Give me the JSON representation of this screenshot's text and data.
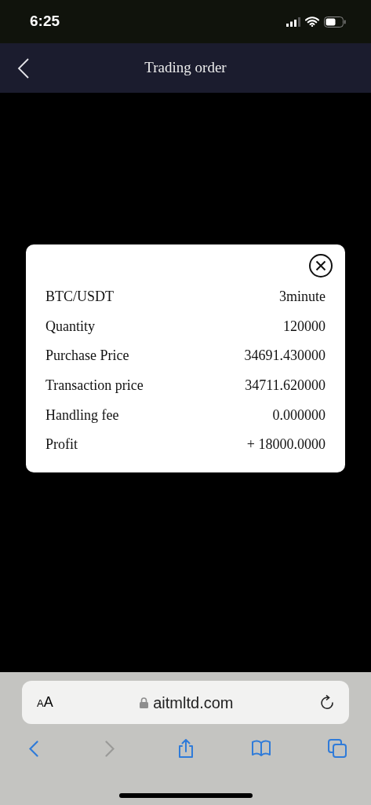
{
  "status_bar": {
    "time": "6:25"
  },
  "header": {
    "title": "Trading order"
  },
  "order_dialog": {
    "rows": [
      {
        "label": "BTC/USDT",
        "value": "3minute"
      },
      {
        "label": "Quantity",
        "value": "120000"
      },
      {
        "label": "Purchase Price",
        "value": "34691.430000"
      },
      {
        "label": "Transaction price",
        "value": "34711.620000"
      },
      {
        "label": "Handling fee",
        "value": "0.000000"
      },
      {
        "label": "Profit",
        "value": "+ 18000.0000"
      }
    ]
  },
  "browser": {
    "text_size_button": "AA",
    "url": "aitmltd.com",
    "toolbar": [
      {
        "kind": "back",
        "disabled": false
      },
      {
        "kind": "forward",
        "disabled": true
      },
      {
        "kind": "share",
        "disabled": false
      },
      {
        "kind": "bookmarks",
        "disabled": false
      },
      {
        "kind": "tabs",
        "disabled": false
      }
    ]
  }
}
